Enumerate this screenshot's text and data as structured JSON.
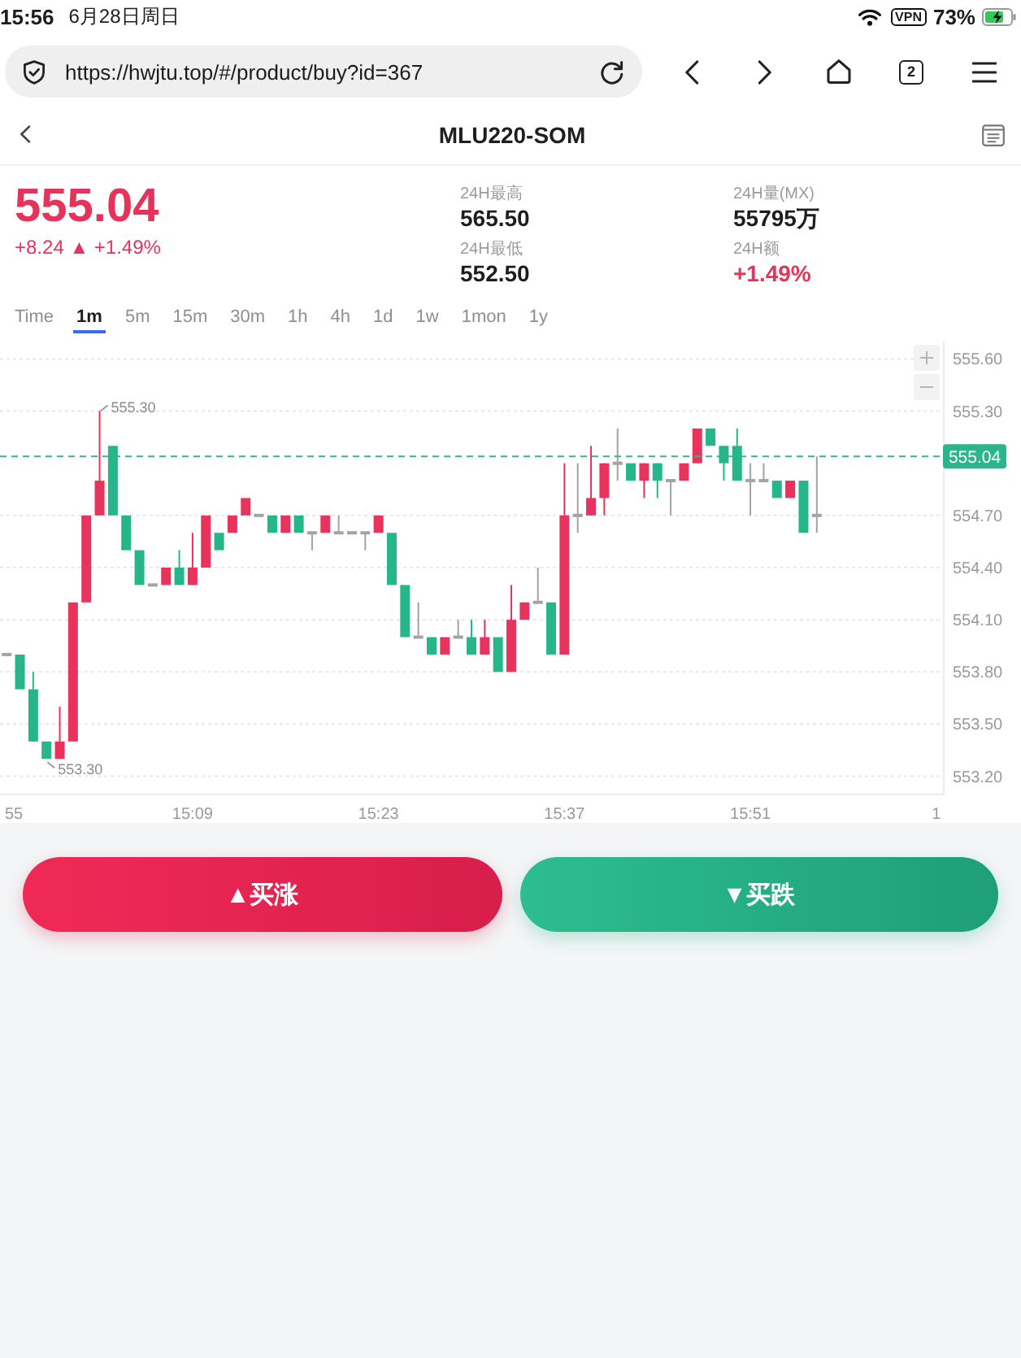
{
  "status_bar": {
    "time": "15:56",
    "date": "6月28日周日",
    "vpn": "VPN",
    "battery": "73%"
  },
  "browser": {
    "url": "https://hwjtu.top/#/product/buy?id=367",
    "tab_count": "2"
  },
  "header": {
    "title": "MLU220-SOM"
  },
  "quote": {
    "price": "555.04",
    "change": "+8.24 ▲ +1.49%",
    "rising": true
  },
  "stats": [
    {
      "label": "24H最高",
      "value": "565.50",
      "color": "#1d1d1f"
    },
    {
      "label": "24H量(MX)",
      "value": "55795万",
      "color": "#1d1d1f"
    },
    {
      "label": "24H最低",
      "value": "552.50",
      "color": "#1d1d1f"
    },
    {
      "label": "24H额",
      "value": "+1.49%",
      "color": "#e5335b"
    }
  ],
  "timeframes": [
    {
      "label": "Time",
      "selected": false
    },
    {
      "label": "1m",
      "selected": true
    },
    {
      "label": "5m",
      "selected": false
    },
    {
      "label": "15m",
      "selected": false
    },
    {
      "label": "30m",
      "selected": false
    },
    {
      "label": "1h",
      "selected": false
    },
    {
      "label": "4h",
      "selected": false
    },
    {
      "label": "1d",
      "selected": false
    },
    {
      "label": "1w",
      "selected": false
    },
    {
      "label": "1mon",
      "selected": false
    },
    {
      "label": "1y",
      "selected": false
    }
  ],
  "chart": {
    "chart_data": {
      "type": "candlestick",
      "categories": [
        "55",
        null,
        null,
        null,
        null,
        null,
        null,
        null,
        null,
        null,
        null,
        null,
        null,
        null,
        "15:09",
        null,
        null,
        null,
        null,
        null,
        null,
        null,
        null,
        null,
        null,
        null,
        null,
        null,
        "15:23",
        null,
        null,
        null,
        null,
        null,
        null,
        null,
        null,
        null,
        null,
        null,
        null,
        null,
        "15:37",
        null,
        null,
        null,
        null,
        null,
        null,
        null,
        null,
        null,
        null,
        null,
        null,
        null,
        "15:51",
        null,
        null,
        null,
        null,
        null,
        null,
        null,
        null,
        null,
        null,
        null,
        null,
        null,
        "1"
      ],
      "ohlc": [
        [
          553.9,
          553.9,
          553.9,
          553.9
        ],
        [
          553.9,
          553.9,
          553.7,
          553.7
        ],
        [
          553.7,
          553.8,
          553.4,
          553.4
        ],
        [
          553.4,
          553.4,
          553.3,
          553.3
        ],
        [
          553.3,
          553.6,
          553.3,
          553.4
        ],
        [
          553.4,
          554.2,
          553.4,
          554.2
        ],
        [
          554.2,
          554.7,
          554.2,
          554.7
        ],
        [
          554.7,
          555.3,
          554.7,
          554.9
        ],
        [
          555.1,
          555.1,
          554.7,
          554.7
        ],
        [
          554.7,
          554.7,
          554.5,
          554.5
        ],
        [
          554.5,
          554.5,
          554.3,
          554.3
        ],
        [
          554.3,
          554.3,
          554.3,
          554.3
        ],
        [
          554.3,
          554.4,
          554.3,
          554.4
        ],
        [
          554.4,
          554.5,
          554.3,
          554.3
        ],
        [
          554.3,
          554.6,
          554.3,
          554.4
        ],
        [
          554.4,
          554.7,
          554.4,
          554.7
        ],
        [
          554.6,
          554.6,
          554.5,
          554.5
        ],
        [
          554.6,
          554.7,
          554.6,
          554.7
        ],
        [
          554.7,
          554.8,
          554.7,
          554.8
        ],
        [
          554.7,
          554.7,
          554.7,
          554.7
        ],
        [
          554.7,
          554.7,
          554.6,
          554.6
        ],
        [
          554.6,
          554.7,
          554.6,
          554.7
        ],
        [
          554.7,
          554.7,
          554.6,
          554.6
        ],
        [
          554.6,
          554.6,
          554.5,
          554.6
        ],
        [
          554.6,
          554.7,
          554.6,
          554.7
        ],
        [
          554.6,
          554.7,
          554.6,
          554.6
        ],
        [
          554.6,
          554.6,
          554.6,
          554.6
        ],
        [
          554.6,
          554.6,
          554.5,
          554.6
        ],
        [
          554.6,
          554.7,
          554.6,
          554.7
        ],
        [
          554.6,
          554.6,
          554.3,
          554.3
        ],
        [
          554.3,
          554.3,
          554.0,
          554.0
        ],
        [
          554.0,
          554.2,
          554.0,
          554.0
        ],
        [
          554.0,
          554.0,
          553.9,
          553.9
        ],
        [
          553.9,
          554.0,
          553.9,
          554.0
        ],
        [
          554.0,
          554.1,
          554.0,
          554.0
        ],
        [
          554.0,
          554.1,
          553.9,
          553.9
        ],
        [
          553.9,
          554.1,
          553.9,
          554.0
        ],
        [
          554.0,
          554.0,
          553.8,
          553.8
        ],
        [
          553.8,
          554.3,
          553.8,
          554.1
        ],
        [
          554.1,
          554.2,
          554.1,
          554.2
        ],
        [
          554.2,
          554.4,
          554.2,
          554.2
        ],
        [
          554.2,
          554.2,
          553.9,
          553.9
        ],
        [
          553.9,
          555.0,
          553.9,
          554.7
        ],
        [
          554.7,
          555.0,
          554.6,
          554.7
        ],
        [
          554.7,
          555.1,
          554.7,
          554.8
        ],
        [
          554.8,
          555.0,
          554.7,
          555.0
        ],
        [
          555.0,
          555.2,
          554.9,
          555.0
        ],
        [
          555.0,
          555.0,
          554.9,
          554.9
        ],
        [
          554.9,
          555.0,
          554.8,
          555.0
        ],
        [
          555.0,
          555.0,
          554.8,
          554.9
        ],
        [
          554.9,
          554.9,
          554.7,
          554.9
        ],
        [
          554.9,
          555.0,
          554.9,
          555.0
        ],
        [
          555.0,
          555.2,
          555.0,
          555.2
        ],
        [
          555.2,
          555.2,
          555.1,
          555.1
        ],
        [
          555.1,
          555.1,
          554.9,
          555.0
        ],
        [
          555.1,
          555.2,
          554.9,
          554.9
        ],
        [
          554.9,
          555.0,
          554.7,
          554.9
        ],
        [
          554.9,
          555.0,
          554.9,
          554.9
        ],
        [
          554.9,
          554.9,
          554.8,
          554.8
        ],
        [
          554.8,
          554.9,
          554.8,
          554.9
        ],
        [
          554.9,
          554.9,
          554.6,
          554.6
        ],
        [
          554.7,
          555.04,
          554.6,
          554.7
        ],
        null,
        null,
        null,
        null,
        null,
        null,
        null,
        null,
        null
      ],
      "ylim": [
        553.1,
        555.7
      ],
      "yticks": [
        {
          "value": 555.6,
          "label": "555.60"
        },
        {
          "value": 555.3,
          "label": "555.30"
        },
        {
          "value": 554.7,
          "label": "554.70"
        },
        {
          "value": 554.4,
          "label": "554.40"
        },
        {
          "value": 554.1,
          "label": "554.10"
        },
        {
          "value": 553.8,
          "label": "553.80"
        },
        {
          "value": 553.5,
          "label": "553.50"
        },
        {
          "value": 553.2,
          "label": "553.20"
        }
      ],
      "grid": true,
      "ref_lines": [
        {
          "axis": "y",
          "value": 555.04,
          "label": "555.04"
        }
      ],
      "annotations": [
        "555.30",
        "553.30"
      ]
    }
  },
  "actions": [
    {
      "label": "▲买涨",
      "kind": "buy_up"
    },
    {
      "label": "▼买跌",
      "kind": "buy_down"
    }
  ]
}
